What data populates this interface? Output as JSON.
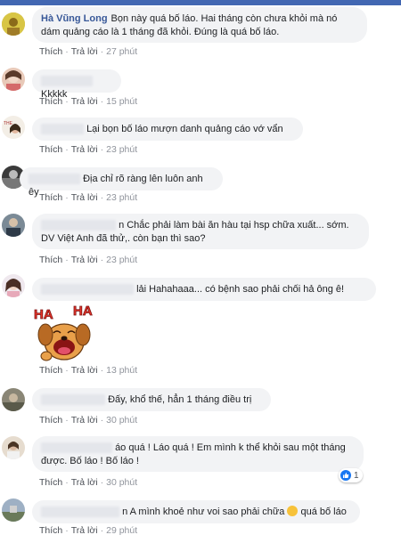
{
  "topbar_color": "#4267b2",
  "comments": [
    {
      "name": "Hà Vũng Long",
      "text": "Bọn này quá bố láo. Hai tháng còn chưa khỏi mà nó dám quảng cáo là 1 tháng đã khỏi. Đúng là quá bố láo.",
      "time": "27 phút"
    },
    {
      "text": "Kkkkk",
      "time": "15 phút"
    },
    {
      "text": "Lại bọn bố láo mượn danh quảng cáo vớ vẩn",
      "time": "23 phút"
    },
    {
      "text": "Địa chỉ rõ ràng lên luôn anh êy",
      "time": "23 phút"
    },
    {
      "text": "n Chắc phải làm bài ăn hàu tại hsp chữa xuất... sớm. DV Việt Anh đã thử,. còn bạn thì sao?",
      "time": "23 phút"
    },
    {
      "text": "lải Hahahaaa... có bệnh sao phải chối hả ông ê!",
      "time": "13 phút",
      "sticker": {
        "left": "HA",
        "right": "HA"
      }
    },
    {
      "text": "Đấy, khổ thế, hẳn 1 tháng điều trị",
      "time": "30 phút"
    },
    {
      "text": "áo quá ! Láo quá ! Em mình k thể khỏi sau một tháng được. Bố láo ! Bố láo !",
      "time": "30 phút",
      "reactions": "1"
    },
    {
      "text": "n A mình khoẻ như voi sao phải chữa",
      "text_after": "quá bố láo",
      "time": "29 phút"
    }
  ],
  "labels": {
    "like": "Thích",
    "reply": "Trả lời",
    "dot": "·"
  },
  "icons": {
    "like": "like-icon",
    "laugh_emoji": "grinning-sweat-emoji-icon"
  }
}
